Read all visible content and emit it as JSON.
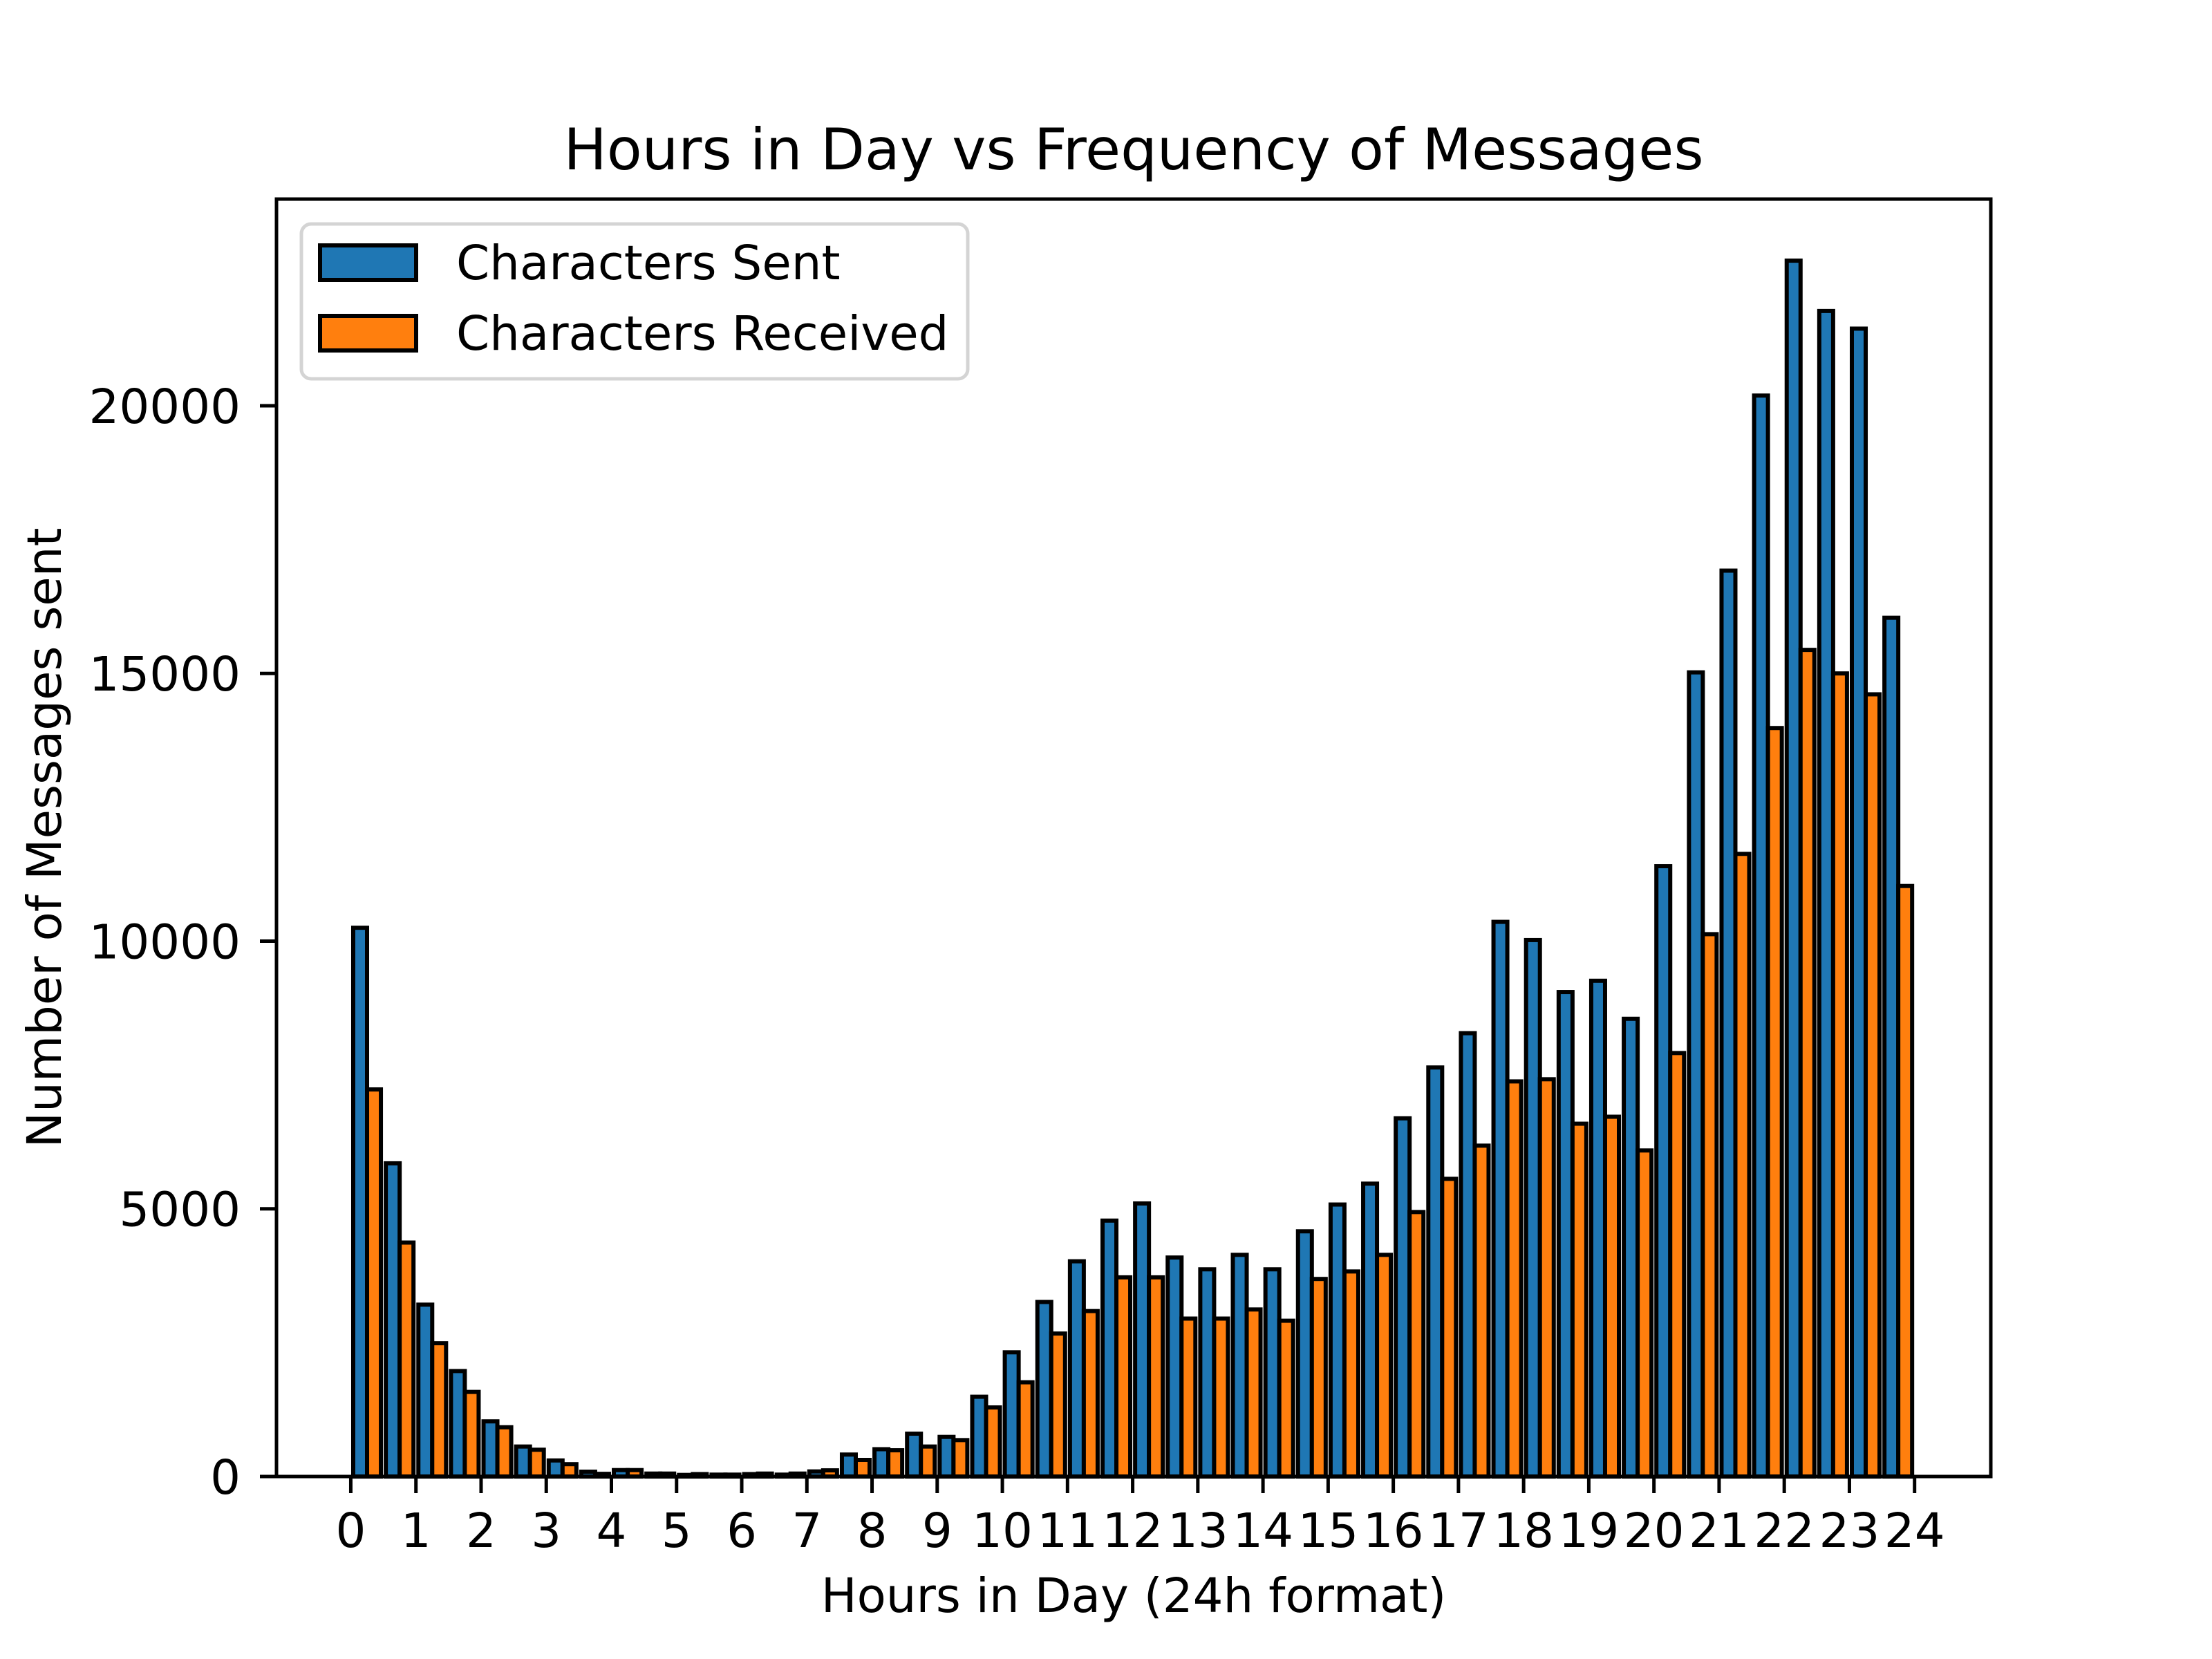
{
  "chart_data": {
    "type": "bar",
    "subtype": "grouped-histogram",
    "title": "Hours in Day vs Frequency of Messages",
    "xlabel": "Hours in Day (24h format)",
    "ylabel": "Number of Messages sent",
    "bin_width_hours": 0.5,
    "bin_starts": [
      0,
      0.5,
      1,
      1.5,
      2,
      2.5,
      3,
      3.5,
      4,
      4.5,
      5,
      5.5,
      6,
      6.5,
      7,
      7.5,
      8,
      8.5,
      9,
      9.5,
      10,
      10.5,
      11,
      11.5,
      12,
      12.5,
      13,
      13.5,
      14,
      14.5,
      15,
      15.5,
      16,
      16.5,
      17,
      17.5,
      18,
      18.5,
      19,
      19.5,
      20,
      20.5,
      21,
      21.5,
      22,
      22.5,
      23,
      23.5
    ],
    "series": [
      {
        "name": "Characters Sent",
        "color": "#1f77b4",
        "values": [
          10250,
          5850,
          3210,
          1970,
          1030,
          560,
          300,
          90,
          120,
          55,
          30,
          35,
          45,
          35,
          95,
          410,
          510,
          800,
          740,
          1490,
          2320,
          3260,
          4020,
          4780,
          5100,
          4090,
          3870,
          4140,
          3870,
          4580,
          5080,
          5470,
          6690,
          7640,
          8280,
          10360,
          10020,
          9050,
          9260,
          8550,
          11400,
          15020,
          16920,
          20190,
          22710,
          21770,
          21440,
          16040
        ]
      },
      {
        "name": "Characters Received",
        "color": "#ff7f0e",
        "values": [
          7230,
          4370,
          2490,
          1580,
          920,
          500,
          230,
          50,
          120,
          55,
          45,
          35,
          55,
          55,
          115,
          310,
          490,
          560,
          680,
          1290,
          1760,
          2670,
          3090,
          3720,
          3720,
          2950,
          2950,
          3120,
          2910,
          3690,
          3830,
          4140,
          4940,
          5560,
          6180,
          7380,
          7420,
          6590,
          6720,
          6090,
          7910,
          10130,
          11630,
          13980,
          15440,
          15000,
          14610,
          11030
        ]
      }
    ],
    "xticks": [
      0,
      1,
      2,
      3,
      4,
      5,
      6,
      7,
      8,
      9,
      10,
      11,
      12,
      13,
      14,
      15,
      16,
      17,
      18,
      19,
      20,
      21,
      22,
      23,
      24
    ],
    "xtick_labels": [
      "0",
      "1",
      "2",
      "3",
      "4",
      "5",
      "6",
      "7",
      "8",
      "9",
      "10",
      "11",
      "12",
      "13",
      "14",
      "15",
      "16",
      "17",
      "18",
      "19",
      "20",
      "21",
      "22",
      "23",
      "24"
    ],
    "yticks": [
      0,
      5000,
      10000,
      15000,
      20000
    ],
    "ytick_labels": [
      "0",
      "5000",
      "10000",
      "15000",
      "20000"
    ],
    "xlim": [
      -1.14,
      25.17
    ],
    "ylim": [
      0,
      23860
    ],
    "grid": false,
    "legend": {
      "placement": "top-left",
      "entries": [
        "Characters Sent",
        "Characters Received"
      ]
    },
    "bar_edge_color": "#000000"
  }
}
